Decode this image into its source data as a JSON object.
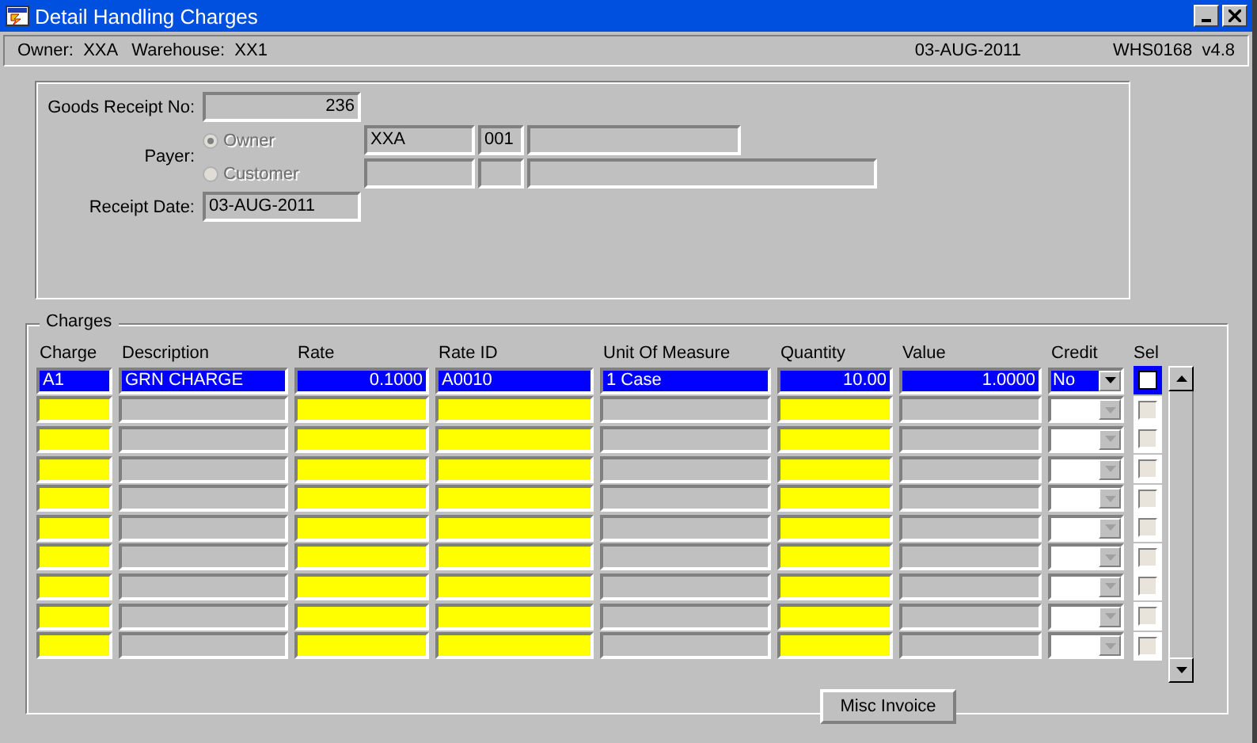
{
  "window": {
    "title": "Detail Handling Charges"
  },
  "info_bar": {
    "context": "Owner:  XXA   Warehouse:  XX1",
    "date": "03-AUG-2011",
    "version": "WHS0168  v4.8"
  },
  "header": {
    "goods_receipt_no": {
      "label": "Goods Receipt No:",
      "value": "236"
    },
    "payer": {
      "label": "Payer:",
      "options": [
        {
          "label": "Owner",
          "selected": true,
          "disabled": true,
          "fields": [
            "XXA",
            "001"
          ]
        },
        {
          "label": "Customer",
          "selected": false,
          "disabled": true
        }
      ]
    },
    "receipt_date": {
      "label": "Receipt Date:",
      "value": "03-AUG-2011"
    }
  },
  "charges": {
    "title": "Charges",
    "columns": [
      {
        "label": "Charge",
        "kind": "mandatory"
      },
      {
        "label": "Description",
        "kind": "text"
      },
      {
        "label": "Rate",
        "kind": "mandatory_number"
      },
      {
        "label": "Rate ID",
        "kind": "mandatory"
      },
      {
        "label": "Unit Of Measure",
        "kind": "text"
      },
      {
        "label": "Quantity",
        "kind": "mandatory_number"
      },
      {
        "label": "Value",
        "kind": "number"
      },
      {
        "label": "Credit",
        "kind": "dropdown"
      },
      {
        "label": "Sel",
        "kind": "checkbox"
      }
    ],
    "rows": [
      {
        "selected": true,
        "cells": [
          "A1",
          "GRN CHARGE",
          "0.1000",
          "A0010",
          "1 Case",
          "10.00",
          "1.0000",
          "No"
        ],
        "checked": false
      },
      {
        "selected": false,
        "checked": false
      },
      {
        "selected": false,
        "checked": false
      },
      {
        "selected": false,
        "checked": false
      },
      {
        "selected": false,
        "checked": false
      },
      {
        "selected": false,
        "checked": false
      },
      {
        "selected": false,
        "checked": false
      },
      {
        "selected": false,
        "checked": false
      },
      {
        "selected": false,
        "checked": false
      },
      {
        "selected": false,
        "checked": false
      }
    ],
    "button": "Misc Invoice"
  }
}
